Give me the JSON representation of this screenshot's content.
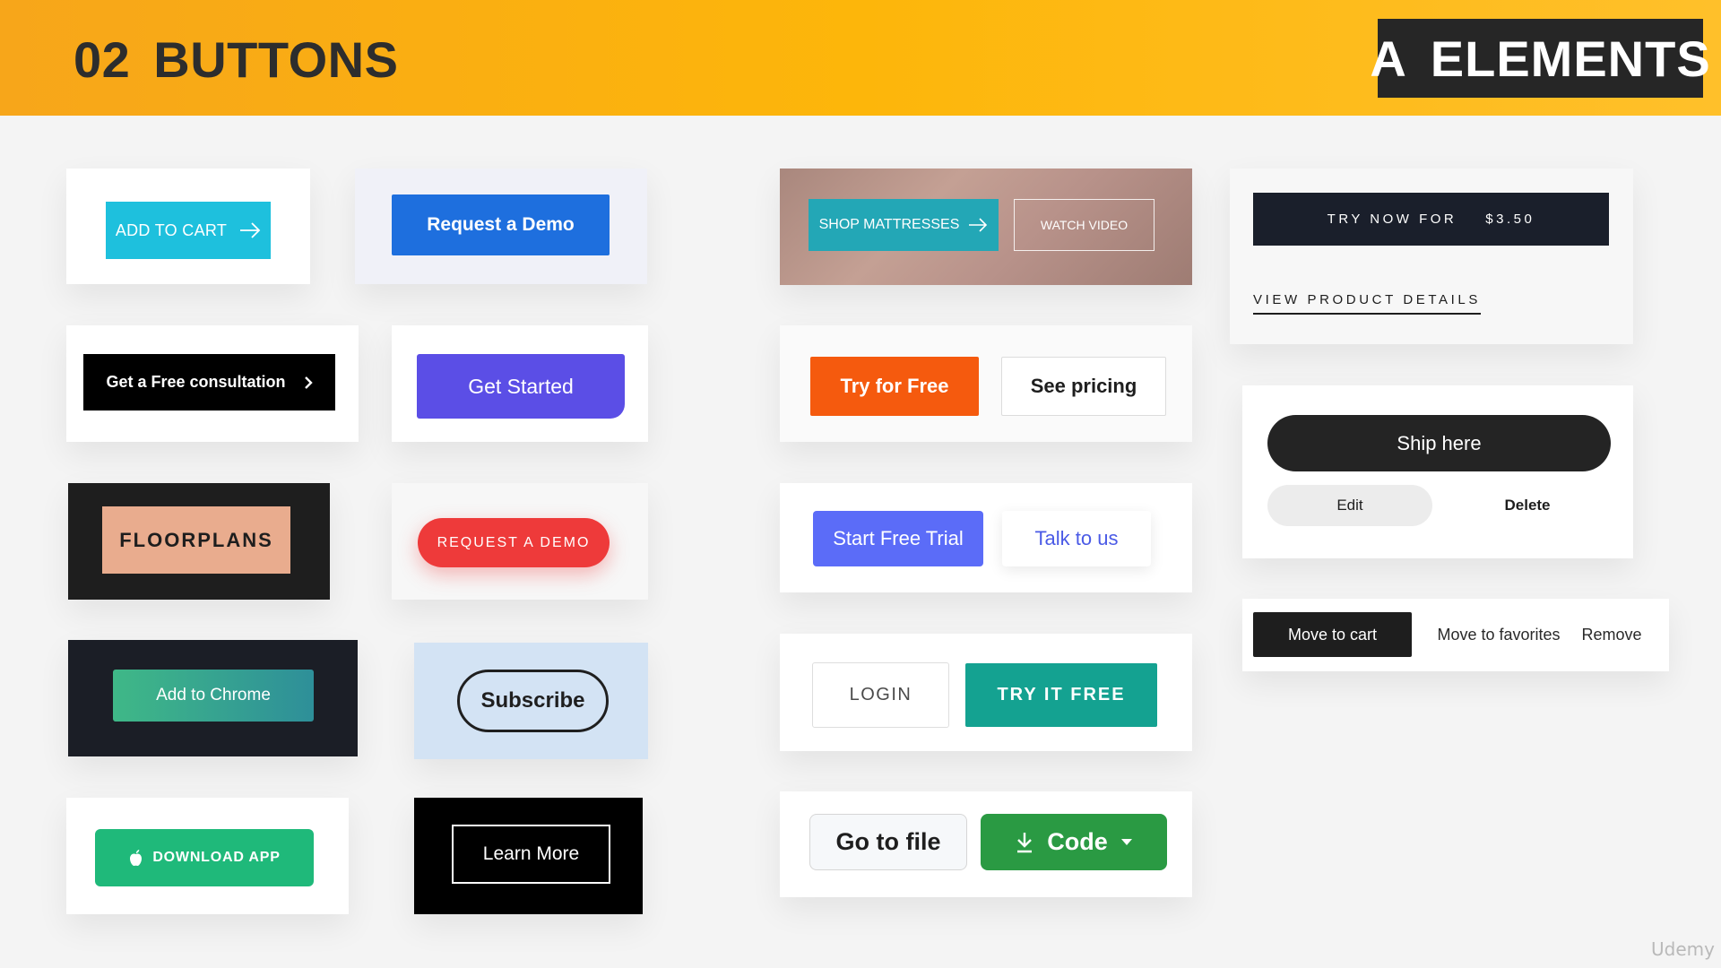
{
  "header": {
    "section_number": "02",
    "section_title": "BUTTONS",
    "badge_letter": "A",
    "badge_title": "ELEMENTS"
  },
  "column1": {
    "add_to_cart": "ADD TO CART",
    "free_consultation": "Get a Free consultation",
    "floorplans": "FLOORPLANS",
    "add_to_chrome": "Add to Chrome",
    "download_app": "DOWNLOAD APP"
  },
  "column2": {
    "request_demo": "Request a Demo",
    "get_started": "Get Started",
    "request_demo_pill": "REQUEST A DEMO",
    "subscribe": "Subscribe",
    "learn_more": "Learn More"
  },
  "column3": {
    "shop_mattresses": "SHOP MATTRESSES",
    "watch_video": "WATCH VIDEO",
    "try_for_free": "Try for Free",
    "see_pricing": "See pricing",
    "start_free_trial": "Start Free Trial",
    "talk_to_us": "Talk to us",
    "login": "LOGIN",
    "try_it_free": "TRY IT FREE",
    "go_to_file": "Go to file",
    "code": "Code"
  },
  "column4": {
    "try_now_for": "TRY NOW FOR",
    "try_now_price": "$3.50",
    "view_product_details": "VIEW PRODUCT DETAILS",
    "ship_here": "Ship here",
    "edit": "Edit",
    "delete": "Delete",
    "move_to_cart": "Move to cart",
    "move_to_favorites": "Move to favorites",
    "remove": "Remove"
  },
  "watermark": "Udemy",
  "icons": [
    "arrow-right-icon",
    "chevron-right-icon",
    "apple-icon",
    "download-icon",
    "caret-down-icon"
  ],
  "colors": {
    "header_orange": "#fdb60a",
    "badge_dark": "#262626",
    "cyan": "#1ec0dd",
    "blue": "#1e6fde",
    "purple": "#5b4ee6",
    "red": "#ee3a3a",
    "orange": "#f55a0e",
    "indigo": "#5b6cf8",
    "teal": "#14a291",
    "github_green": "#2a9a43",
    "green": "#1fb97a"
  }
}
